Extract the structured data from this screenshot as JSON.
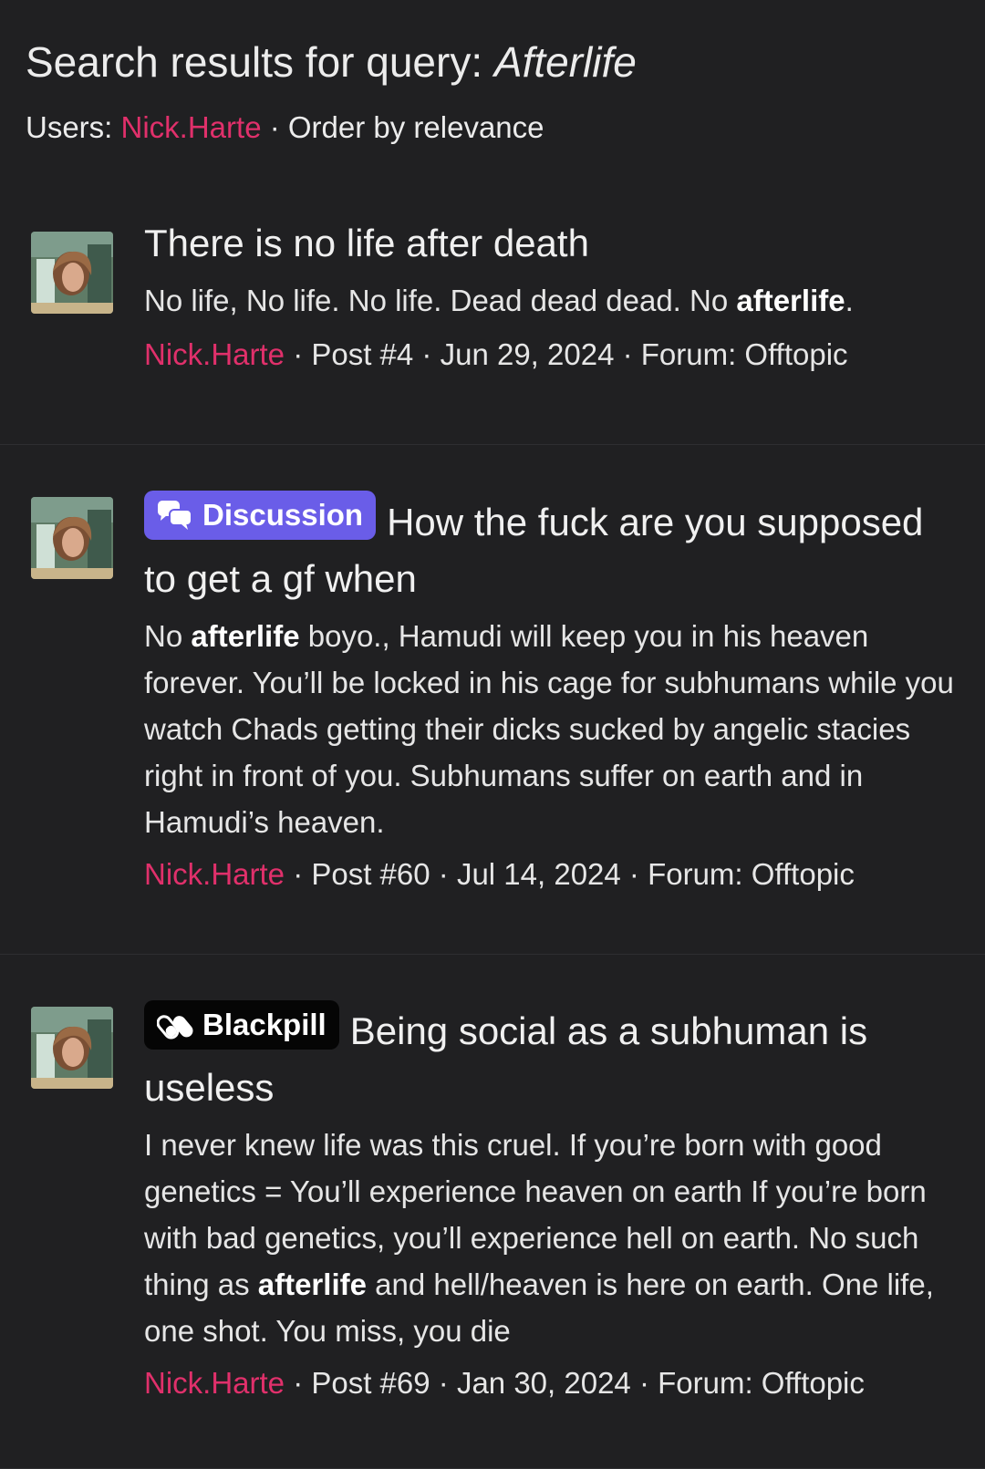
{
  "header": {
    "title_prefix": "Search results for query: ",
    "query": "Afterlife",
    "users_label": "Users: ",
    "user": "Nick.Harte",
    "order": " · Order by relevance"
  },
  "results": [
    {
      "title": "There is no life after death",
      "snippet_before": "No life, No life. No life. Dead dead dead. No ",
      "snippet_bold": "afterlife",
      "snippet_after": ".",
      "author": "Nick.Harte",
      "meta": " · Post #4 · Jun 29, 2024 · Forum: Offtopic"
    },
    {
      "badge": "Discussion",
      "badge_icon": "chat-bubbles-icon",
      "title": "How the fuck are you supposed to get a gf when",
      "snippet_before": "No ",
      "snippet_bold": "afterlife",
      "snippet_after": " boyo., Hamudi will keep you in his heaven forever. You’ll be locked in his cage for subhumans while you watch Chads getting their dicks sucked by angelic stacies right in front of you. Subhumans suffer on earth and in Hamudi’s heaven.",
      "author": "Nick.Harte",
      "meta": " · Post #60 · Jul 14, 2024 · Forum: Offtopic"
    },
    {
      "badge": "Blackpill",
      "badge_icon": "pill-icon",
      "title": "Being social as a subhuman is useless",
      "snippet_before": "I never knew life was this cruel. If you’re born with good genetics = You’ll experience heaven on earth If you’re born with bad genetics, you’ll experience hell on earth. No such thing as ",
      "snippet_bold": "afterlife",
      "snippet_after": " and hell/heaven is here on earth. One life, one shot. You miss, you die",
      "author": "Nick.Harte",
      "meta": " · Post #69 · Jan 30, 2024 · Forum: Offtopic"
    }
  ],
  "colors": {
    "background": "#202022",
    "accent_pink": "#e0306b",
    "discussion_badge": "#6a5de8",
    "blackpill_badge": "#050505"
  }
}
